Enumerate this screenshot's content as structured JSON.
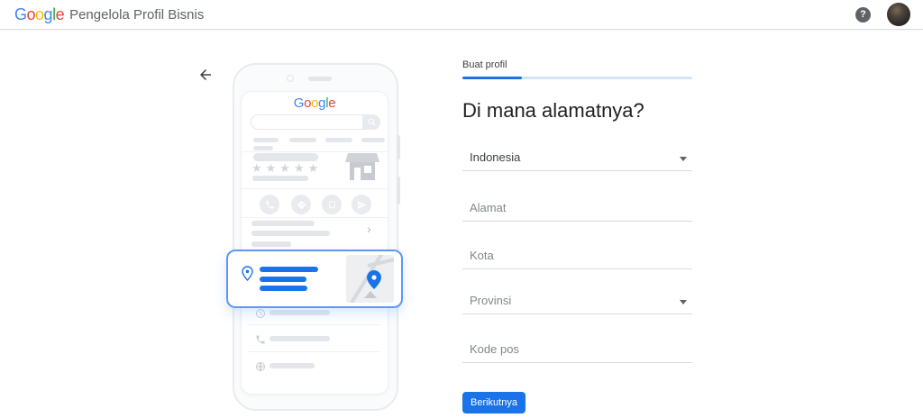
{
  "brand": {
    "logo_letters": [
      {
        "ch": "G",
        "color": "#4285F4"
      },
      {
        "ch": "o",
        "color": "#EA4335"
      },
      {
        "ch": "o",
        "color": "#FBBC05"
      },
      {
        "ch": "g",
        "color": "#4285F4"
      },
      {
        "ch": "l",
        "color": "#34A853"
      },
      {
        "ch": "e",
        "color": "#EA4335"
      }
    ],
    "product_name": "Pengelola Profil Bisnis"
  },
  "icons": {
    "help_glyph": "?",
    "chevron_right": "›",
    "star_row": "★★★★★"
  },
  "form": {
    "step_label": "Buat profil",
    "progress_percent": 26,
    "heading": "Di mana alamatnya?",
    "country_value": "Indonesia",
    "address_placeholder": "Alamat",
    "city_placeholder": "Kota",
    "province_placeholder": "Provinsi",
    "postal_placeholder": "Kode pos",
    "next_button_label": "Berikutnya"
  },
  "colors": {
    "accent_blue": "#1a73e8",
    "progress_track": "#d2e3fc",
    "card_border_blue": "#5e97f6",
    "placeholder_gray": "#80868b",
    "heading_dark": "#202124",
    "header_text_gray": "#5f6368"
  }
}
